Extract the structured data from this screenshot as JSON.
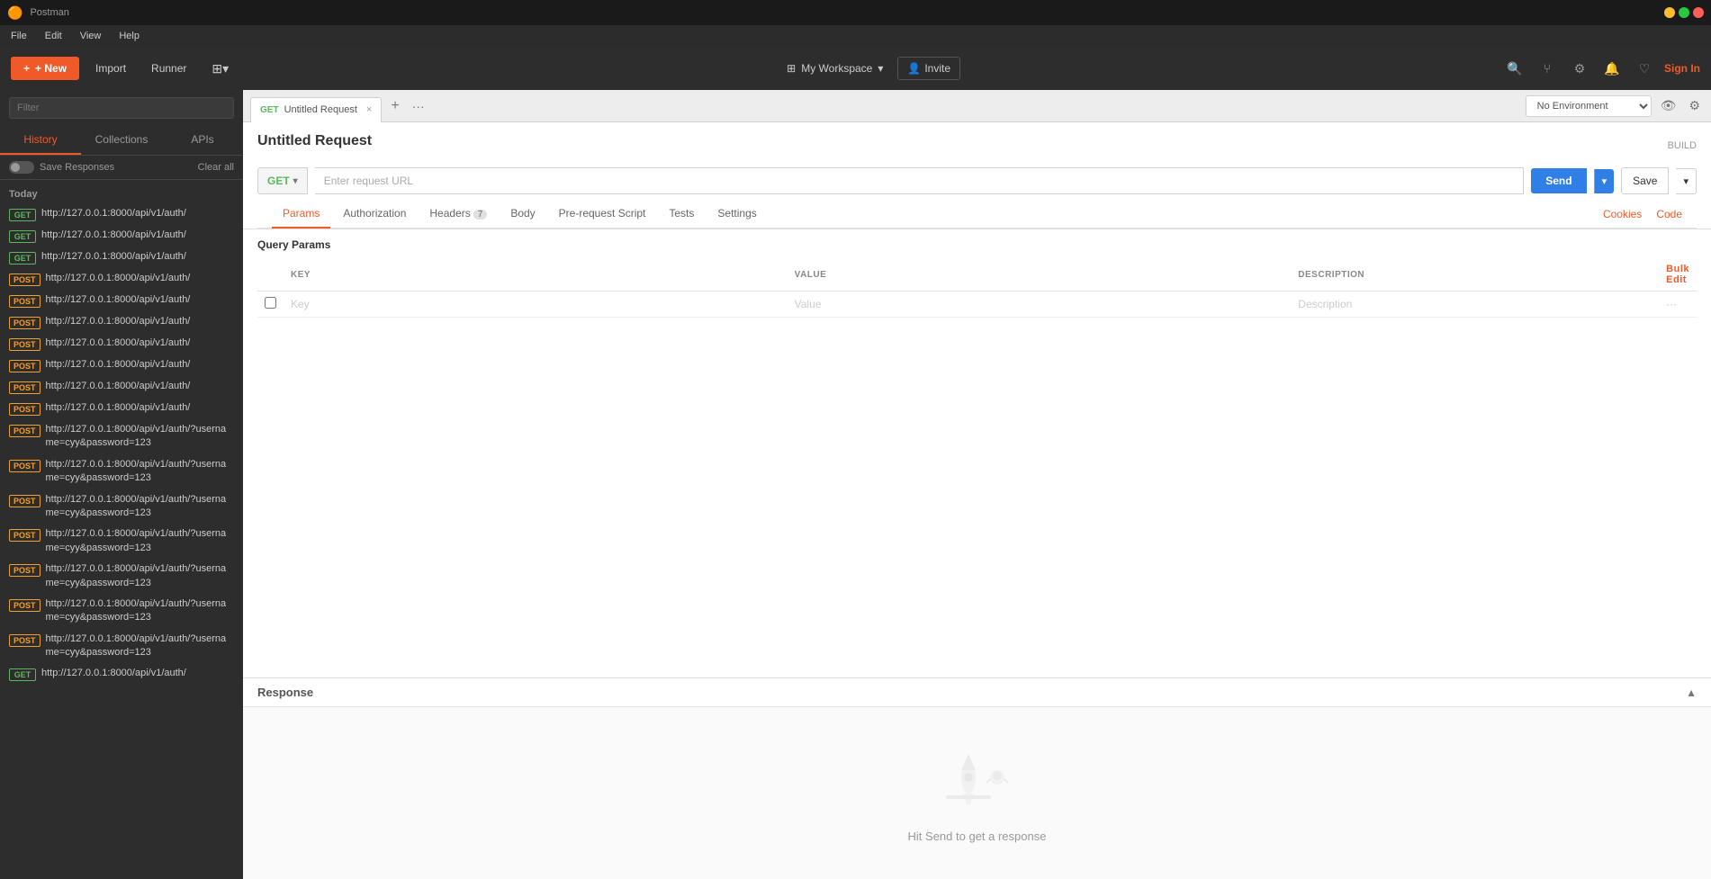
{
  "app": {
    "title": "Postman",
    "logo": "🟠"
  },
  "titlebar": {
    "title": "Postman",
    "close_label": "✕",
    "min_label": "–",
    "max_label": "□"
  },
  "menubar": {
    "items": [
      "File",
      "Edit",
      "View",
      "Help"
    ]
  },
  "toolbar": {
    "new_button": "+ New",
    "import_button": "Import",
    "runner_button": "Runner",
    "workspace_icon": "⊞",
    "workspace_name": "My Workspace",
    "workspace_arrow": "▾",
    "invite_icon": "👤",
    "invite_label": "Invite",
    "sign_in": "Sign In"
  },
  "sidebar": {
    "search_placeholder": "Filter",
    "tabs": [
      "History",
      "Collections",
      "APIs"
    ],
    "active_tab": "History",
    "save_responses_label": "Save Responses",
    "clear_all_label": "Clear all",
    "today_label": "Today",
    "history_items": [
      {
        "method": "GET",
        "url": "http://127.0.0.1:8000/api/v1/auth/"
      },
      {
        "method": "GET",
        "url": "http://127.0.0.1:8000/api/v1/auth/"
      },
      {
        "method": "GET",
        "url": "http://127.0.0.1:8000/api/v1/auth/"
      },
      {
        "method": "POST",
        "url": "http://127.0.0.1:8000/api/v1/auth/"
      },
      {
        "method": "POST",
        "url": "http://127.0.0.1:8000/api/v1/auth/"
      },
      {
        "method": "POST",
        "url": "http://127.0.0.1:8000/api/v1/auth/"
      },
      {
        "method": "POST",
        "url": "http://127.0.0.1:8000/api/v1/auth/"
      },
      {
        "method": "POST",
        "url": "http://127.0.0.1:8000/api/v1/auth/"
      },
      {
        "method": "POST",
        "url": "http://127.0.0.1:8000/api/v1/auth/"
      },
      {
        "method": "POST",
        "url": "http://127.0.0.1:8000/api/v1/auth/"
      },
      {
        "method": "POST",
        "url": "http://127.0.0.1:8000/api/v1/auth/?username=cyy&password=123"
      },
      {
        "method": "POST",
        "url": "http://127.0.0.1:8000/api/v1/auth/?username=cyy&password=123"
      },
      {
        "method": "POST",
        "url": "http://127.0.0.1:8000/api/v1/auth/?username=cyy&password=123"
      },
      {
        "method": "POST",
        "url": "http://127.0.0.1:8000/api/v1/auth/?username=cyy&password=123"
      },
      {
        "method": "POST",
        "url": "http://127.0.0.1:8000/api/v1/auth/?username=cyy&password=123"
      },
      {
        "method": "POST",
        "url": "http://127.0.0.1:8000/api/v1/auth/?username=cyy&password=123"
      },
      {
        "method": "POST",
        "url": "http://127.0.0.1:8000/api/v1/auth/?username=cyy&password=123"
      },
      {
        "method": "GET",
        "url": "http://127.0.0.1:8000/api/v1/auth/"
      }
    ]
  },
  "tabs_bar": {
    "active_tab_method": "GET",
    "active_tab_name": "Untitled Request",
    "close_icon": "×",
    "add_icon": "+",
    "more_icon": "···"
  },
  "env_bar": {
    "no_environment": "No Environment",
    "eye_icon": "👁",
    "settings_icon": "⚙"
  },
  "request": {
    "title": "Untitled Request",
    "build_label": "BUILD",
    "method": "GET",
    "url_placeholder": "Enter request URL",
    "send_label": "Send",
    "save_label": "Save",
    "tabs": [
      {
        "id": "params",
        "label": "Params",
        "badge": null
      },
      {
        "id": "authorization",
        "label": "Authorization",
        "badge": null
      },
      {
        "id": "headers",
        "label": "Headers",
        "badge": "7"
      },
      {
        "id": "body",
        "label": "Body",
        "badge": null
      },
      {
        "id": "pre-request-script",
        "label": "Pre-request Script",
        "badge": null
      },
      {
        "id": "tests",
        "label": "Tests",
        "badge": null
      },
      {
        "id": "settings",
        "label": "Settings",
        "badge": null
      }
    ],
    "active_tab": "params",
    "cookies_label": "Cookies",
    "code_label": "Code",
    "query_params": {
      "title": "Query Params",
      "columns": [
        "KEY",
        "VALUE",
        "DESCRIPTION"
      ],
      "key_placeholder": "Key",
      "value_placeholder": "Value",
      "description_placeholder": "Description",
      "bulk_edit_label": "Bulk Edit"
    }
  },
  "response": {
    "title": "Response",
    "empty_message": "Hit Send to get a response"
  }
}
